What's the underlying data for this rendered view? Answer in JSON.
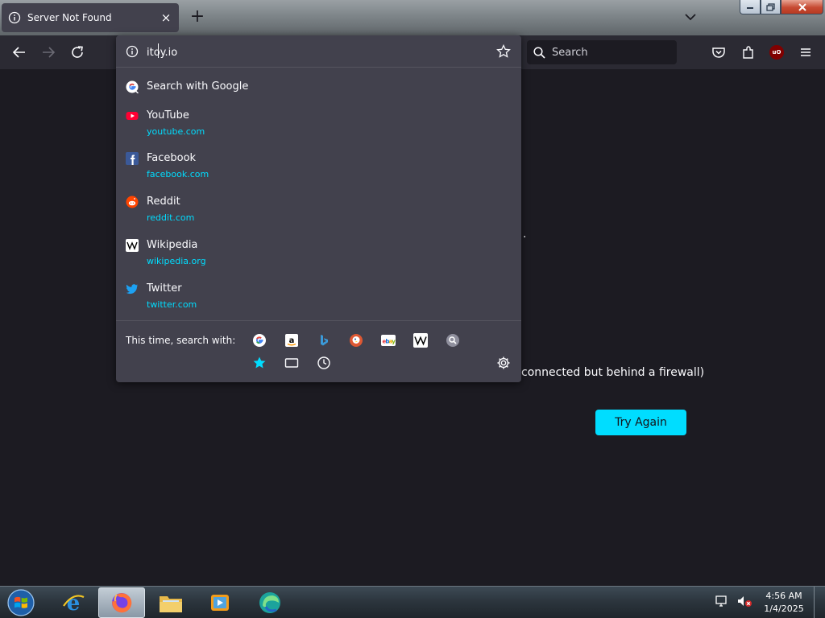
{
  "browser": {
    "tab": {
      "title": "Server Not Found",
      "close_glyph": "×"
    },
    "new_tab_glyph": "+",
    "icons": [
      "info-icon",
      "chevron-down-icon",
      "back-icon",
      "forward-icon",
      "reload-icon",
      "search-icon",
      "pocket-icon",
      "extensions-icon",
      "menu-icon"
    ],
    "search": {
      "placeholder": "Search"
    },
    "ublock_label": "uO",
    "accent": "#00ddff"
  },
  "urlbar": {
    "value": "itoy.io",
    "results": [
      {
        "title": "Search with Google",
        "url": "",
        "icon": "google-icon"
      },
      {
        "title": "YouTube",
        "url": "youtube.com",
        "icon": "youtube-icon"
      },
      {
        "title": "Facebook",
        "url": "facebook.com",
        "icon": "facebook-icon"
      },
      {
        "title": "Reddit",
        "url": "reddit.com",
        "icon": "reddit-icon"
      },
      {
        "title": "Wikipedia",
        "url": "wikipedia.org",
        "icon": "wikipedia-icon"
      },
      {
        "title": "Twitter",
        "url": "twitter.com",
        "icon": "twitter-icon"
      }
    ],
    "one_off_label": "This time, search with:",
    "one_off_engines": [
      "google",
      "amazon",
      "bing",
      "duckduckgo",
      "ebay",
      "wikipedia",
      "search-engine"
    ],
    "one_off_modes": [
      "bookmarks",
      "tabs",
      "history"
    ]
  },
  "page": {
    "dot": ".",
    "message_fragment": "connected but behind a firewall)",
    "try_again_label": "Try Again"
  },
  "taskbar": {
    "apps": [
      "internet-explorer",
      "firefox",
      "file-explorer",
      "media-player",
      "edge-app"
    ],
    "time": "4:56 AM",
    "date": "1/4/2025"
  }
}
